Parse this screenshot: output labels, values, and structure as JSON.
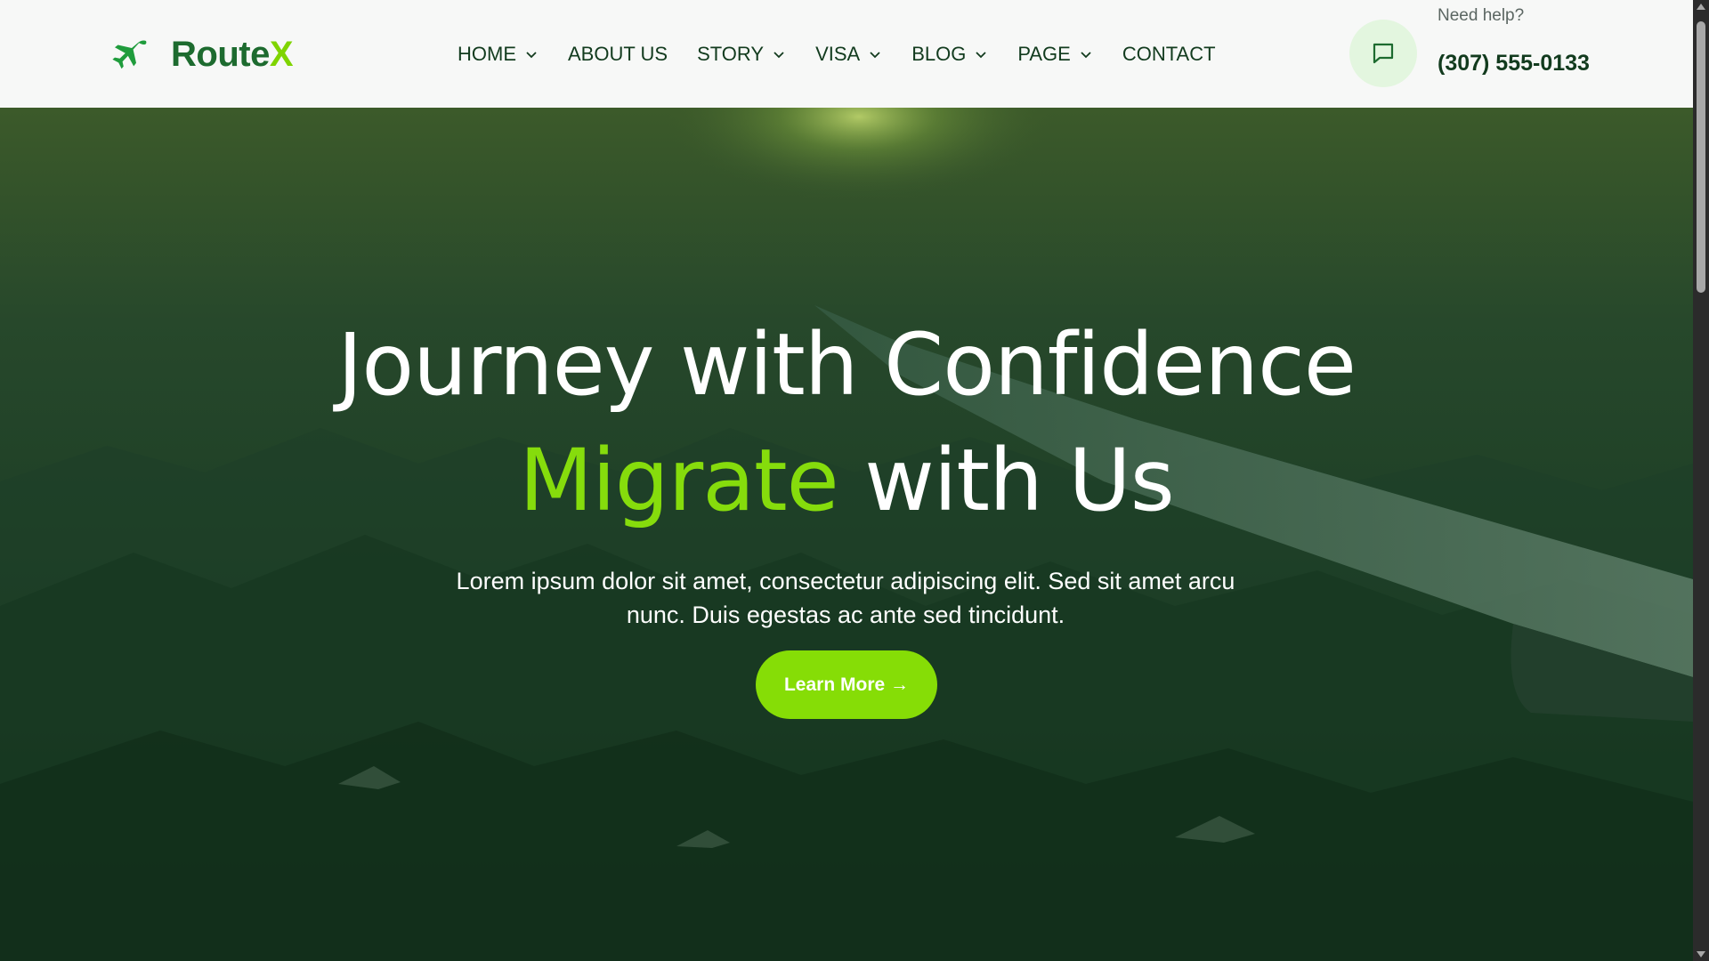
{
  "brand": {
    "name_main": "Route",
    "name_accent": "X",
    "logo_icon": "airplane-icon"
  },
  "nav": {
    "items": [
      {
        "label": "HOME",
        "has_dropdown": true
      },
      {
        "label": "ABOUT US",
        "has_dropdown": false
      },
      {
        "label": "STORY",
        "has_dropdown": true
      },
      {
        "label": "VISA",
        "has_dropdown": true
      },
      {
        "label": "BLOG",
        "has_dropdown": true
      },
      {
        "label": "PAGE",
        "has_dropdown": true
      },
      {
        "label": "CONTACT",
        "has_dropdown": false
      }
    ]
  },
  "help": {
    "label": "Need help?",
    "phone": "(307) 555-0133",
    "icon": "chat-icon"
  },
  "hero": {
    "title_line1": "Journey with Confidence",
    "title_highlight": "Migrate",
    "title_rest": " with Us",
    "subtitle": "Lorem ipsum dolor sit amet, consectetur adipiscing elit. Sed sit amet arcu nunc. Duis egestas ac ante sed tincidunt.",
    "cta_label": "Learn More →",
    "background": "aerial view of mountains from airplane window with wing, green tint"
  },
  "colors": {
    "brand_dark": "#1d6b2f",
    "accent": "#86dc0c",
    "nav_text": "#123b1e",
    "header_bg": "#f7f8f7",
    "hero_overlay": "#16351f"
  }
}
